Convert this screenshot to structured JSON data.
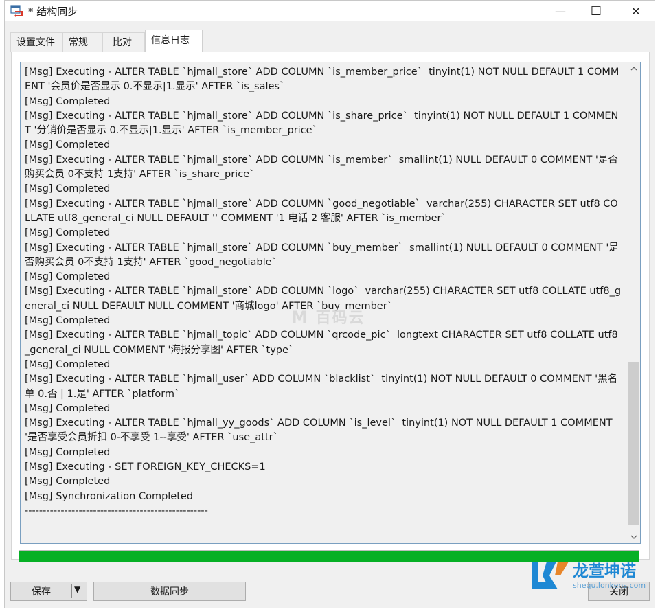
{
  "window": {
    "title": "* 结构同步",
    "minimize_glyph": "—",
    "maximize_glyph": "☐",
    "close_glyph": "✕"
  },
  "tabs": [
    {
      "label": "设置文件"
    },
    {
      "label": "常规"
    },
    {
      "label": "比对"
    },
    {
      "label": "信息日志",
      "active": true
    }
  ],
  "log": {
    "lines": [
      "[Msg] Executing - ALTER TABLE `hjmall_store` ADD COLUMN `is_member_price`  tinyint(1) NOT NULL DEFAULT 1 COMMENT '会员价是否显示 0.不显示|1.显示' AFTER `is_sales`",
      "[Msg] Completed",
      "[Msg] Executing - ALTER TABLE `hjmall_store` ADD COLUMN `is_share_price`  tinyint(1) NOT NULL DEFAULT 1 COMMENT '分销价是否显示 0.不显示|1.显示' AFTER `is_member_price`",
      "[Msg] Completed",
      "[Msg] Executing - ALTER TABLE `hjmall_store` ADD COLUMN `is_member`  smallint(1) NULL DEFAULT 0 COMMENT '是否购买会员 0不支持 1支持' AFTER `is_share_price`",
      "[Msg] Completed",
      "[Msg] Executing - ALTER TABLE `hjmall_store` ADD COLUMN `good_negotiable`  varchar(255) CHARACTER SET utf8 COLLATE utf8_general_ci NULL DEFAULT '' COMMENT '1 电话 2 客服' AFTER `is_member`",
      "[Msg] Completed",
      "[Msg] Executing - ALTER TABLE `hjmall_store` ADD COLUMN `buy_member`  smallint(1) NULL DEFAULT 0 COMMENT '是否购买会员 0不支持 1支持' AFTER `good_negotiable`",
      "[Msg] Completed",
      "[Msg] Executing - ALTER TABLE `hjmall_store` ADD COLUMN `logo`  varchar(255) CHARACTER SET utf8 COLLATE utf8_general_ci NULL DEFAULT NULL COMMENT '商城logo' AFTER `buy_member`",
      "[Msg] Completed",
      "[Msg] Executing - ALTER TABLE `hjmall_topic` ADD COLUMN `qrcode_pic`  longtext CHARACTER SET utf8 COLLATE utf8_general_ci NULL COMMENT '海报分享图' AFTER `type`",
      "[Msg] Completed",
      "[Msg] Executing - ALTER TABLE `hjmall_user` ADD COLUMN `blacklist`  tinyint(1) NOT NULL DEFAULT 0 COMMENT '黑名单 0.否 | 1.是' AFTER `platform`",
      "[Msg] Completed",
      "[Msg] Executing - ALTER TABLE `hjmall_yy_goods` ADD COLUMN `is_level`  tinyint(1) NOT NULL DEFAULT 1 COMMENT '是否享受会员折扣 0-不享受 1--享受' AFTER `use_attr`",
      "[Msg] Completed",
      "[Msg] Executing - SET FOREIGN_KEY_CHECKS=1",
      "[Msg] Completed",
      "[Msg] Synchronization Completed",
      "---------------------------------------------------"
    ]
  },
  "progress": {
    "value": 1.0,
    "color": "#06b025"
  },
  "buttons": {
    "save": "保存",
    "save_dropdown": "▼",
    "sync": "数据同步",
    "close": "关闭"
  },
  "watermark": {
    "text": "百码云"
  },
  "brand": {
    "logo_letters": "LK",
    "name": "龙萱坤诺",
    "url": "shequ.lonkens.com"
  }
}
